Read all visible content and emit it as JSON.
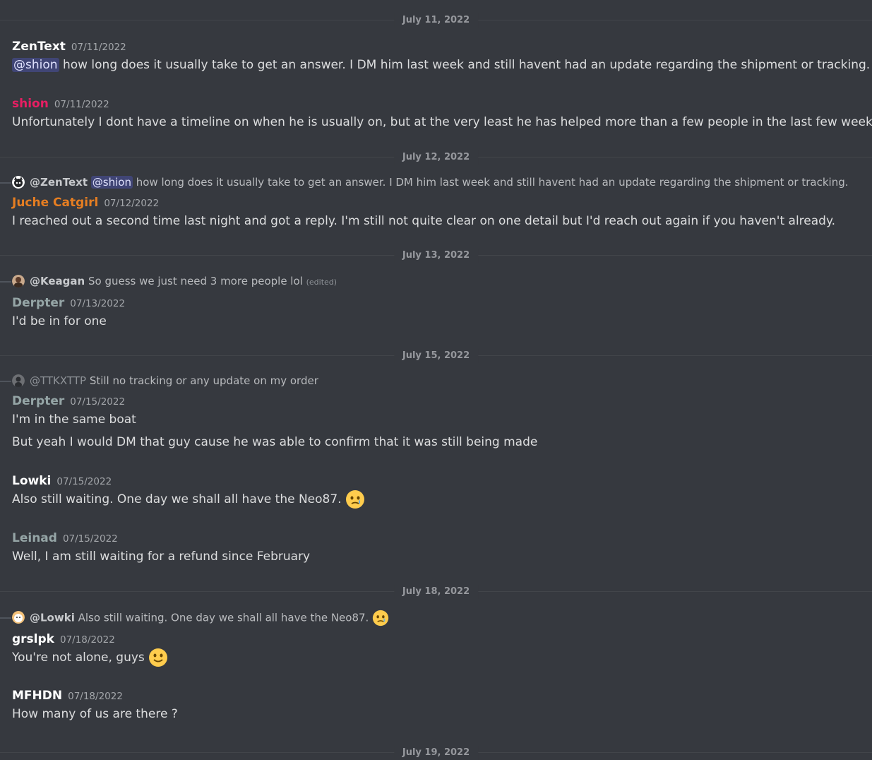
{
  "dividers": [
    {
      "date": "July 11, 2022"
    },
    {
      "date": "July 12, 2022"
    },
    {
      "date": "July 13, 2022"
    },
    {
      "date": "July 15, 2022"
    },
    {
      "date": "July 18, 2022"
    },
    {
      "date": "July 19, 2022"
    }
  ],
  "messages": [
    {
      "author": "ZenText",
      "color": "#ffffff",
      "timestamp": "07/11/2022",
      "mention": "@shion",
      "text": "how long does it usually take to get an answer. I DM him last week and still havent had an update regarding the shipment or tracking."
    },
    {
      "author": "shion",
      "color": "#e91e63",
      "timestamp": "07/11/2022",
      "text": "Unfortunately I dont have a timeline on when he is usually on, but at the very least he has helped more than a few people in the last few weeks"
    },
    {
      "author": "Juche Catgirl",
      "color": "#e67e22",
      "timestamp": "07/12/2022",
      "text": "I reached out a second time last night and got a reply. I'm still not quite clear on one detail but I'd reach out again if you haven't already.",
      "reply": {
        "user": "@ZenText",
        "mention": "@shion",
        "text": "how long does it usually take to get an answer. I DM him last week and still havent had an update regarding the shipment or tracking."
      }
    },
    {
      "author": "Derpter",
      "color": "#95a5a6",
      "timestamp": "07/13/2022",
      "text": "I'd be in for one",
      "reply": {
        "user": "@Keagan",
        "text": "So guess we just need 3 more people lol",
        "edited": "(edited)"
      }
    },
    {
      "author": "Derpter",
      "color": "#95a5a6",
      "timestamp": "07/15/2022",
      "text": "I'm in the same boat",
      "text2": "But yeah I would DM that guy cause he was able to confirm that it was still being made",
      "reply": {
        "user": "@TTKXTTP",
        "text": "Still no tracking or any update on my order"
      }
    },
    {
      "author": "Lowki",
      "color": "#ffffff",
      "timestamp": "07/15/2022",
      "text": "Also still waiting. One day we shall all have the Neo87.",
      "emoji": "face-holding-back-tears"
    },
    {
      "author": "Leinad",
      "color": "#95a5a6",
      "timestamp": "07/15/2022",
      "text": "Well, I am still waiting for a refund since February"
    },
    {
      "author": "grslpk",
      "color": "#ffffff",
      "timestamp": "07/18/2022",
      "text": "You're not alone, guys",
      "emoji": "slightly-smiling-face",
      "reply": {
        "user": "@Lowki",
        "text": "Also still waiting. One day we shall all have the Neo87.",
        "emoji": "face-holding-back-tears"
      }
    },
    {
      "author": "MFHDN",
      "color": "#ffffff",
      "timestamp": "07/18/2022",
      "text": "How many of us are there ?"
    }
  ]
}
